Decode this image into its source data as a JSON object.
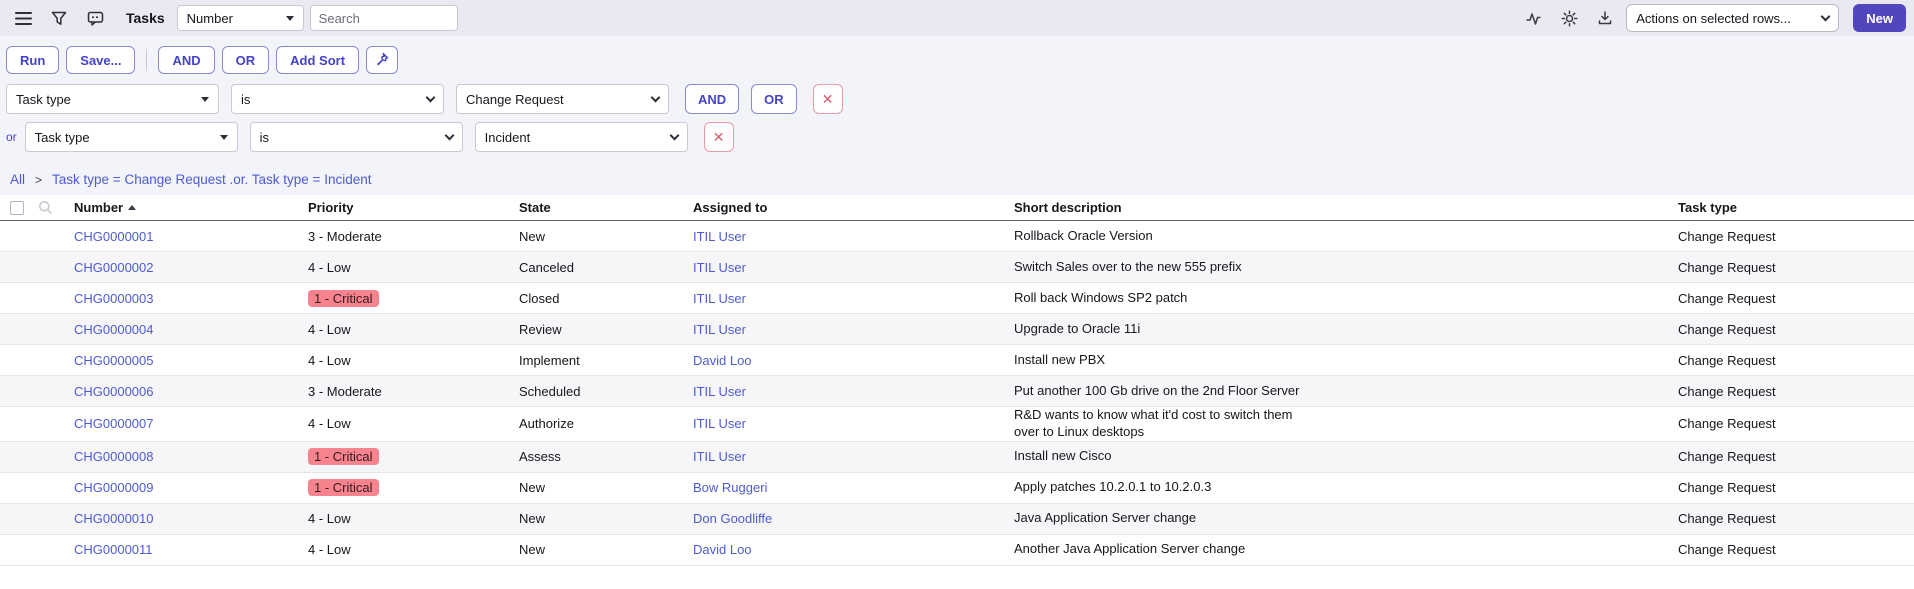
{
  "header": {
    "title": "Tasks",
    "search_field_selector": "Number",
    "search_placeholder": "Search",
    "actions_dropdown": "Actions on selected rows...",
    "new_button": "New"
  },
  "filter_toolbar": {
    "run": "Run",
    "save": "Save...",
    "and": "AND",
    "or": "OR",
    "add_sort": "Add Sort"
  },
  "conditions": [
    {
      "field": "Task type",
      "operator": "is",
      "value": "Change Request",
      "and_label": "AND",
      "or_label": "OR"
    },
    {
      "prefix": "or",
      "field": "Task type",
      "operator": "is",
      "value": "Incident"
    }
  ],
  "breadcrumb": {
    "root": "All",
    "separator": ">",
    "query": "Task type = Change Request .or. Task type = Incident"
  },
  "icons": {
    "remove": "✕"
  },
  "table": {
    "columns": {
      "number": "Number",
      "priority": "Priority",
      "state": "State",
      "assigned_to": "Assigned to",
      "short_description": "Short description",
      "task_type": "Task type"
    },
    "sort": {
      "column": "Number",
      "direction": "ascending"
    },
    "rows": [
      {
        "number": "CHG0000001",
        "priority": "3 - Moderate",
        "critical": false,
        "state": "New",
        "assigned_to": "ITIL User",
        "short_description": "Rollback Oracle Version",
        "task_type": "Change Request"
      },
      {
        "number": "CHG0000002",
        "priority": "4 - Low",
        "critical": false,
        "state": "Canceled",
        "assigned_to": "ITIL User",
        "short_description": "Switch Sales over to the new 555 prefix",
        "task_type": "Change Request"
      },
      {
        "number": "CHG0000003",
        "priority": "1 - Critical",
        "critical": true,
        "state": "Closed",
        "assigned_to": "ITIL User",
        "short_description": "Roll back Windows SP2 patch",
        "task_type": "Change Request"
      },
      {
        "number": "CHG0000004",
        "priority": "4 - Low",
        "critical": false,
        "state": "Review",
        "assigned_to": "ITIL User",
        "short_description": "Upgrade to Oracle 11i",
        "task_type": "Change Request"
      },
      {
        "number": "CHG0000005",
        "priority": "4 - Low",
        "critical": false,
        "state": "Implement",
        "assigned_to": "David Loo",
        "short_description": "Install new PBX",
        "task_type": "Change Request"
      },
      {
        "number": "CHG0000006",
        "priority": "3 - Moderate",
        "critical": false,
        "state": "Scheduled",
        "assigned_to": "ITIL User",
        "short_description": "Put another 100 Gb drive on the 2nd Floor Server",
        "task_type": "Change Request"
      },
      {
        "number": "CHG0000007",
        "priority": "4 - Low",
        "critical": false,
        "state": "Authorize",
        "assigned_to": "ITIL User",
        "short_description": "R&D wants to know what it'd cost to switch them\nover to Linux desktops",
        "task_type": "Change Request"
      },
      {
        "number": "CHG0000008",
        "priority": "1 - Critical",
        "critical": true,
        "state": "Assess",
        "assigned_to": "ITIL User",
        "short_description": "Install new Cisco",
        "task_type": "Change Request"
      },
      {
        "number": "CHG0000009",
        "priority": "1 - Critical",
        "critical": true,
        "state": "New",
        "assigned_to": "Bow Ruggeri",
        "short_description": "Apply patches 10.2.0.1 to 10.2.0.3",
        "task_type": "Change Request"
      },
      {
        "number": "CHG0000010",
        "priority": "4 - Low",
        "critical": false,
        "state": "New",
        "assigned_to": "Don Goodliffe",
        "short_description": "Java Application Server change",
        "task_type": "Change Request"
      },
      {
        "number": "CHG0000011",
        "priority": "4 - Low",
        "critical": false,
        "state": "New",
        "assigned_to": "David Loo",
        "short_description": "Another Java Application Server change",
        "task_type": "Change Request"
      }
    ]
  },
  "colors": {
    "accent": "#5146bd",
    "link": "#4d5bd3",
    "critical_badge_bg": "#f7838e",
    "danger": "#dd5a6b",
    "row_stripe": "#f6f6f9",
    "panel_bg": "#f3f3fa",
    "topbar_bg": "#e9e9f1"
  }
}
